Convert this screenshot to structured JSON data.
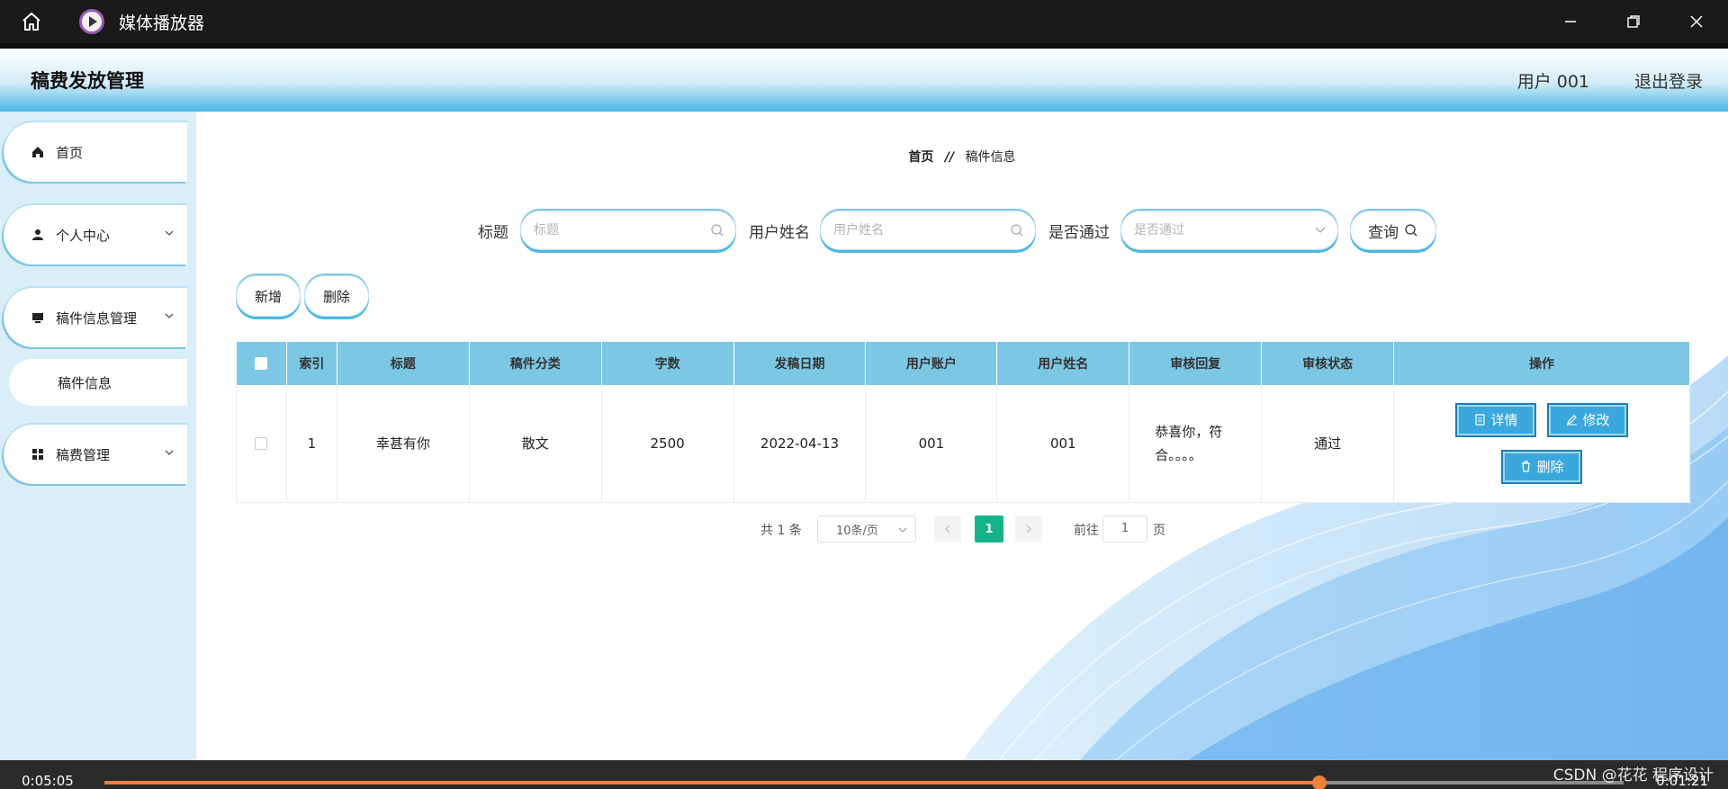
{
  "window": {
    "title": "媒体播放器"
  },
  "header": {
    "app_title": "稿费发放管理",
    "user": "用户 001",
    "logout": "退出登录"
  },
  "sidebar": {
    "items": [
      {
        "label": "首页",
        "icon": "home-icon"
      },
      {
        "label": "个人中心",
        "icon": "user-icon"
      },
      {
        "label": "稿件信息管理",
        "icon": "monitor-icon"
      },
      {
        "label": "稿件信息",
        "icon": ""
      },
      {
        "label": "稿费管理",
        "icon": "grid-icon"
      }
    ]
  },
  "breadcrumb": {
    "home": "首页",
    "separator": "//",
    "current": "稿件信息"
  },
  "search": {
    "title_label": "标题",
    "title_placeholder": "标题",
    "name_label": "用户姓名",
    "name_placeholder": "用户姓名",
    "pass_label": "是否通过",
    "pass_placeholder": "是否通过",
    "query_label": "查询"
  },
  "actions": {
    "add": "新增",
    "delete": "删除"
  },
  "table": {
    "columns": [
      "",
      "索引",
      "标题",
      "稿件分类",
      "字数",
      "发稿日期",
      "用户账户",
      "用户姓名",
      "审核回复",
      "审核状态",
      "操作"
    ],
    "rows": [
      {
        "index": "1",
        "title": "幸甚有你",
        "category": "散文",
        "words": "2500",
        "date": "2022-04-13",
        "account": "001",
        "name": "001",
        "reply": "恭喜你，符合。。。。",
        "status": "通过"
      }
    ],
    "row_actions": {
      "detail": "详情",
      "edit": "修改",
      "delete": "删除"
    }
  },
  "pagination": {
    "total": "共 1 条",
    "page_size": "10条/页",
    "current": "1",
    "goto_label": "前往",
    "goto_value": "1",
    "page_suffix": "页"
  },
  "player": {
    "elapsed": "0:05:05",
    "remaining": "0:01:21",
    "progress": 0.8,
    "watermark": "CSDN @花花 程序设计"
  },
  "colors": {
    "accent": "#4bb5e6",
    "table_header": "#7cc8e4",
    "op_button": "#3aa8dc",
    "pager_active": "#16b38a",
    "progress": "#f07f3c"
  }
}
